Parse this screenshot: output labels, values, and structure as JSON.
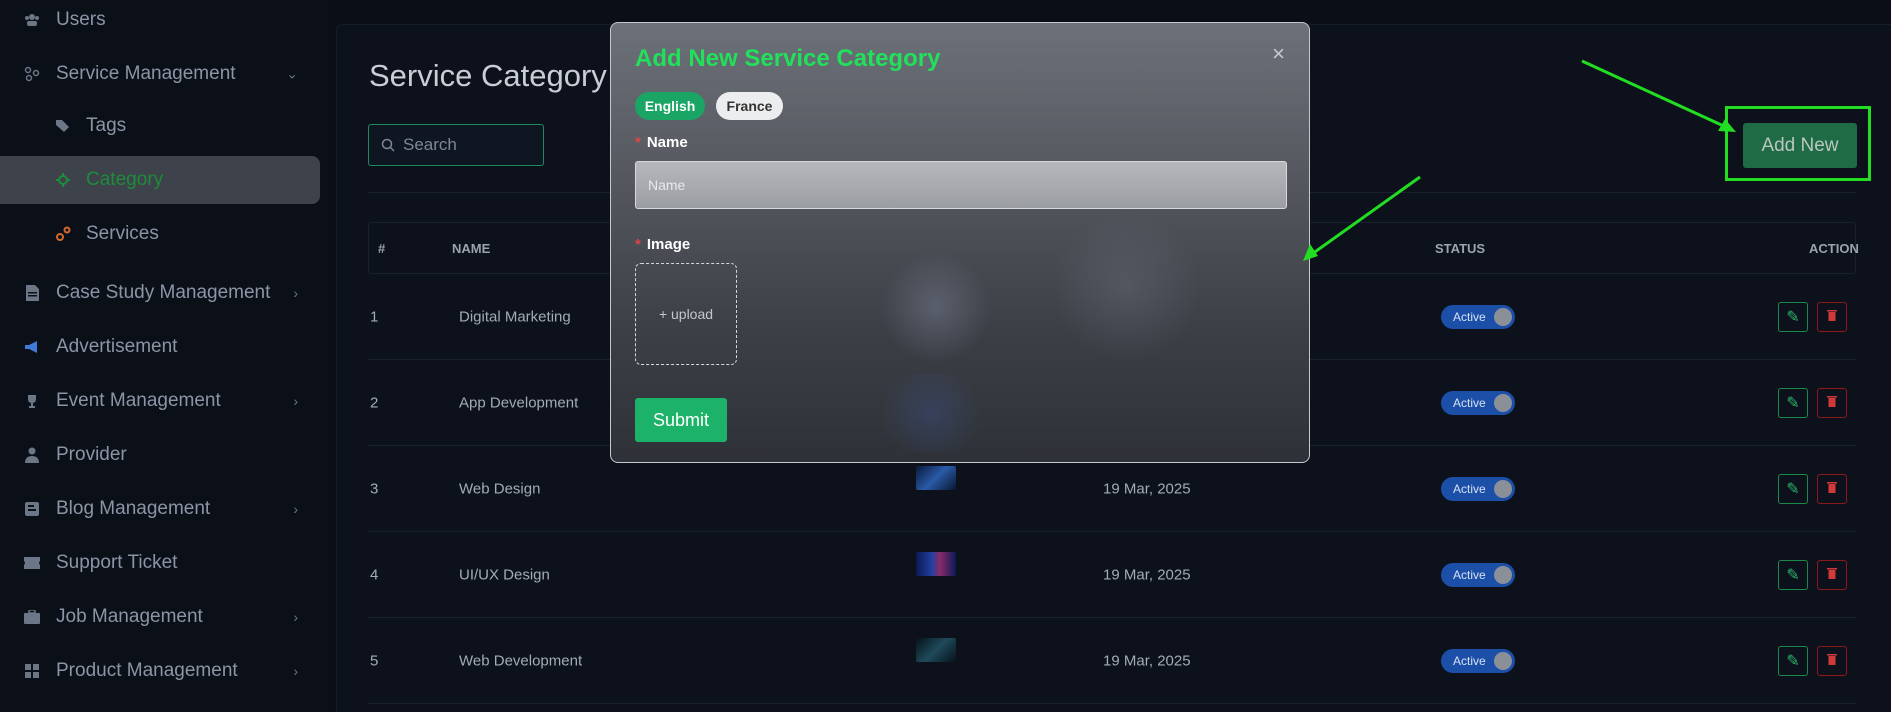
{
  "sidebar": {
    "items": [
      {
        "label": "Users",
        "icon": "users-icon"
      },
      {
        "label": "Service Management",
        "icon": "service-icon"
      },
      {
        "label": "Tags",
        "icon": "tags-icon"
      },
      {
        "label": "Category",
        "icon": "category-icon"
      },
      {
        "label": "Services",
        "icon": "services-icon"
      },
      {
        "label": "Case Study Management",
        "icon": "document-icon"
      },
      {
        "label": "Advertisement",
        "icon": "megaphone-icon"
      },
      {
        "label": "Event Management",
        "icon": "trophy-icon"
      },
      {
        "label": "Provider",
        "icon": "provider-icon"
      },
      {
        "label": "Blog Management",
        "icon": "blog-icon"
      },
      {
        "label": "Support Ticket",
        "icon": "ticket-icon"
      },
      {
        "label": "Job Management",
        "icon": "briefcase-icon"
      },
      {
        "label": "Product Management",
        "icon": "product-icon"
      }
    ]
  },
  "page": {
    "title": "Service Category L",
    "search_placeholder": "Search",
    "add_new_label": "Add New"
  },
  "table": {
    "headers": [
      "#",
      "NAME",
      "STATUS",
      "ACTION"
    ],
    "rows": [
      {
        "num": "1",
        "name": "Digital Marketing",
        "date": "",
        "status": "Active"
      },
      {
        "num": "2",
        "name": "App Development",
        "date": "",
        "status": "Active"
      },
      {
        "num": "3",
        "name": "Web Design",
        "date": "19 Mar, 2025",
        "status": "Active"
      },
      {
        "num": "4",
        "name": "UI/UX Design",
        "date": "19 Mar, 2025",
        "status": "Active"
      },
      {
        "num": "5",
        "name": "Web Development",
        "date": "19 Mar, 2025",
        "status": "Active"
      }
    ]
  },
  "modal": {
    "title": "Add New Service Category",
    "close": "×",
    "lang_english": "English",
    "lang_france": "France",
    "name_label": "Name",
    "name_placeholder": "Name",
    "image_label": "Image",
    "upload_label": "+ upload",
    "submit_label": "Submit",
    "required_mark": "*"
  },
  "colors": {
    "accent_green": "#21e05a",
    "annotation_green": "#22dd22",
    "status_blue": "#1c4fa8"
  }
}
